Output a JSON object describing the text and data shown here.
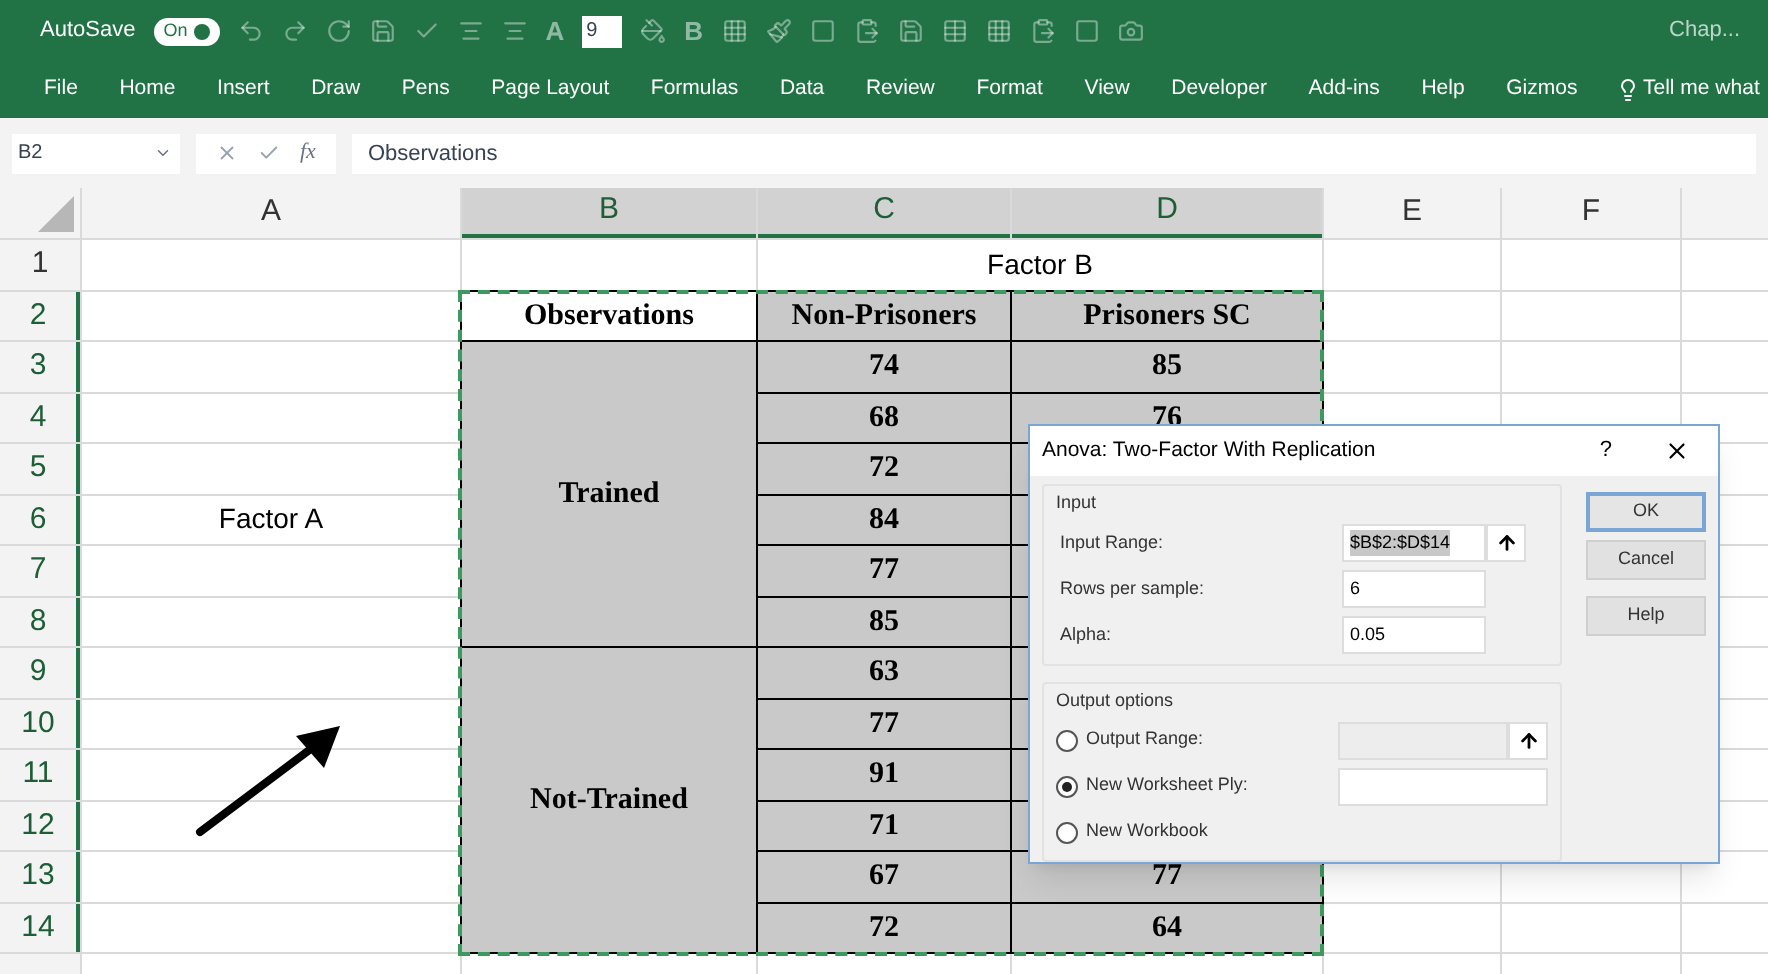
{
  "quick_access": {
    "autosave_label": "AutoSave",
    "autosave_on": true,
    "autosave_state": "On",
    "items": [
      {
        "kind": "undo"
      },
      {
        "kind": "redo"
      },
      {
        "kind": "refresh"
      },
      {
        "kind": "save"
      },
      {
        "kind": "check"
      },
      {
        "kind": "align"
      },
      {
        "kind": "align"
      },
      {
        "kind": "glyph",
        "label": "A"
      },
      {
        "kind": "font-size",
        "label": "9"
      },
      {
        "kind": "fill"
      },
      {
        "kind": "glyph",
        "label": "B"
      },
      {
        "kind": "grid"
      },
      {
        "kind": "brush"
      },
      {
        "kind": "border"
      },
      {
        "kind": "paste"
      },
      {
        "kind": "save"
      },
      {
        "kind": "table"
      },
      {
        "kind": "grid"
      },
      {
        "kind": "paste"
      },
      {
        "kind": "border"
      },
      {
        "kind": "camera"
      }
    ],
    "doc_title": "Chap..."
  },
  "ribbon_tabs": [
    {
      "label": "File",
      "selected": false
    },
    {
      "label": "Home",
      "selected": false
    },
    {
      "label": "Insert",
      "selected": false
    },
    {
      "label": "Draw",
      "selected": false
    },
    {
      "label": "Pens",
      "selected": false
    },
    {
      "label": "Page Layout",
      "selected": false
    },
    {
      "label": "Formulas",
      "selected": false
    },
    {
      "label": "Data",
      "selected": false
    },
    {
      "label": "Review",
      "selected": false
    },
    {
      "label": "Format",
      "selected": false
    },
    {
      "label": "View",
      "selected": false
    },
    {
      "label": "Developer",
      "selected": false
    },
    {
      "label": "Add-ins",
      "selected": false
    },
    {
      "label": "Help",
      "selected": false
    },
    {
      "label": "Gizmos",
      "selected": false
    }
  ],
  "tell_me": "Tell me what",
  "formula_bar": {
    "name_box": "B2",
    "fx": "fx",
    "value": "Observations"
  },
  "columns": [
    {
      "label": "A",
      "selected": false
    },
    {
      "label": "B",
      "selected": true
    },
    {
      "label": "C",
      "selected": true
    },
    {
      "label": "D",
      "selected": true
    },
    {
      "label": "E",
      "selected": false
    },
    {
      "label": "F",
      "selected": false
    }
  ],
  "rows": [
    {
      "label": "1",
      "selected": false
    },
    {
      "label": "2",
      "selected": true
    },
    {
      "label": "3",
      "selected": true
    },
    {
      "label": "4",
      "selected": true
    },
    {
      "label": "5",
      "selected": true
    },
    {
      "label": "6",
      "selected": true
    },
    {
      "label": "7",
      "selected": true
    },
    {
      "label": "8",
      "selected": true
    },
    {
      "label": "9",
      "selected": true
    },
    {
      "label": "10",
      "selected": true
    },
    {
      "label": "11",
      "selected": true
    },
    {
      "label": "12",
      "selected": true
    },
    {
      "label": "13",
      "selected": true
    },
    {
      "label": "14",
      "selected": true
    }
  ],
  "sheet": {
    "factor_b": "Factor B",
    "factor_a": "Factor A",
    "headers": [
      "Observations",
      "Non-Prisoners",
      "Prisoners SC"
    ],
    "groups": [
      {
        "label": "Trained",
        "rows": [
          {
            "non_prisoners": "74",
            "prisoners_sc": "85"
          },
          {
            "non_prisoners": "68",
            "prisoners_sc": "76"
          },
          {
            "non_prisoners": "72"
          },
          {
            "non_prisoners": "84"
          },
          {
            "non_prisoners": "77"
          },
          {
            "non_prisoners": "85"
          }
        ]
      },
      {
        "label": "Not-Trained",
        "rows": [
          {
            "non_prisoners": "63"
          },
          {
            "non_prisoners": "77"
          },
          {
            "non_prisoners": "91"
          },
          {
            "non_prisoners": "71"
          },
          {
            "non_prisoners": "67",
            "prisoners_sc": "77"
          },
          {
            "non_prisoners": "72",
            "prisoners_sc": "64"
          }
        ]
      }
    ]
  },
  "dialog": {
    "title": "Anova: Two-Factor With Replication",
    "help_glyph": "?",
    "input_group": "Input",
    "input_fields": [
      {
        "label": "Input Range:",
        "value": "$B$2:$D$14",
        "range_picker": true
      },
      {
        "label": "Rows per sample:",
        "value": "6",
        "range_picker": false
      },
      {
        "label": "Alpha:",
        "value": "0.05",
        "range_picker": false
      }
    ],
    "output_group": "Output options",
    "output_options": [
      {
        "label": "Output Range:",
        "selected": false,
        "kind": "range"
      },
      {
        "label": "New Worksheet Ply:",
        "selected": true,
        "kind": "text"
      },
      {
        "label": "New Workbook",
        "selected": false,
        "kind": "plain"
      }
    ],
    "buttons": [
      {
        "label": "OK",
        "default": true
      },
      {
        "label": "Cancel",
        "default": false
      },
      {
        "label": "Help",
        "default": false
      }
    ]
  }
}
